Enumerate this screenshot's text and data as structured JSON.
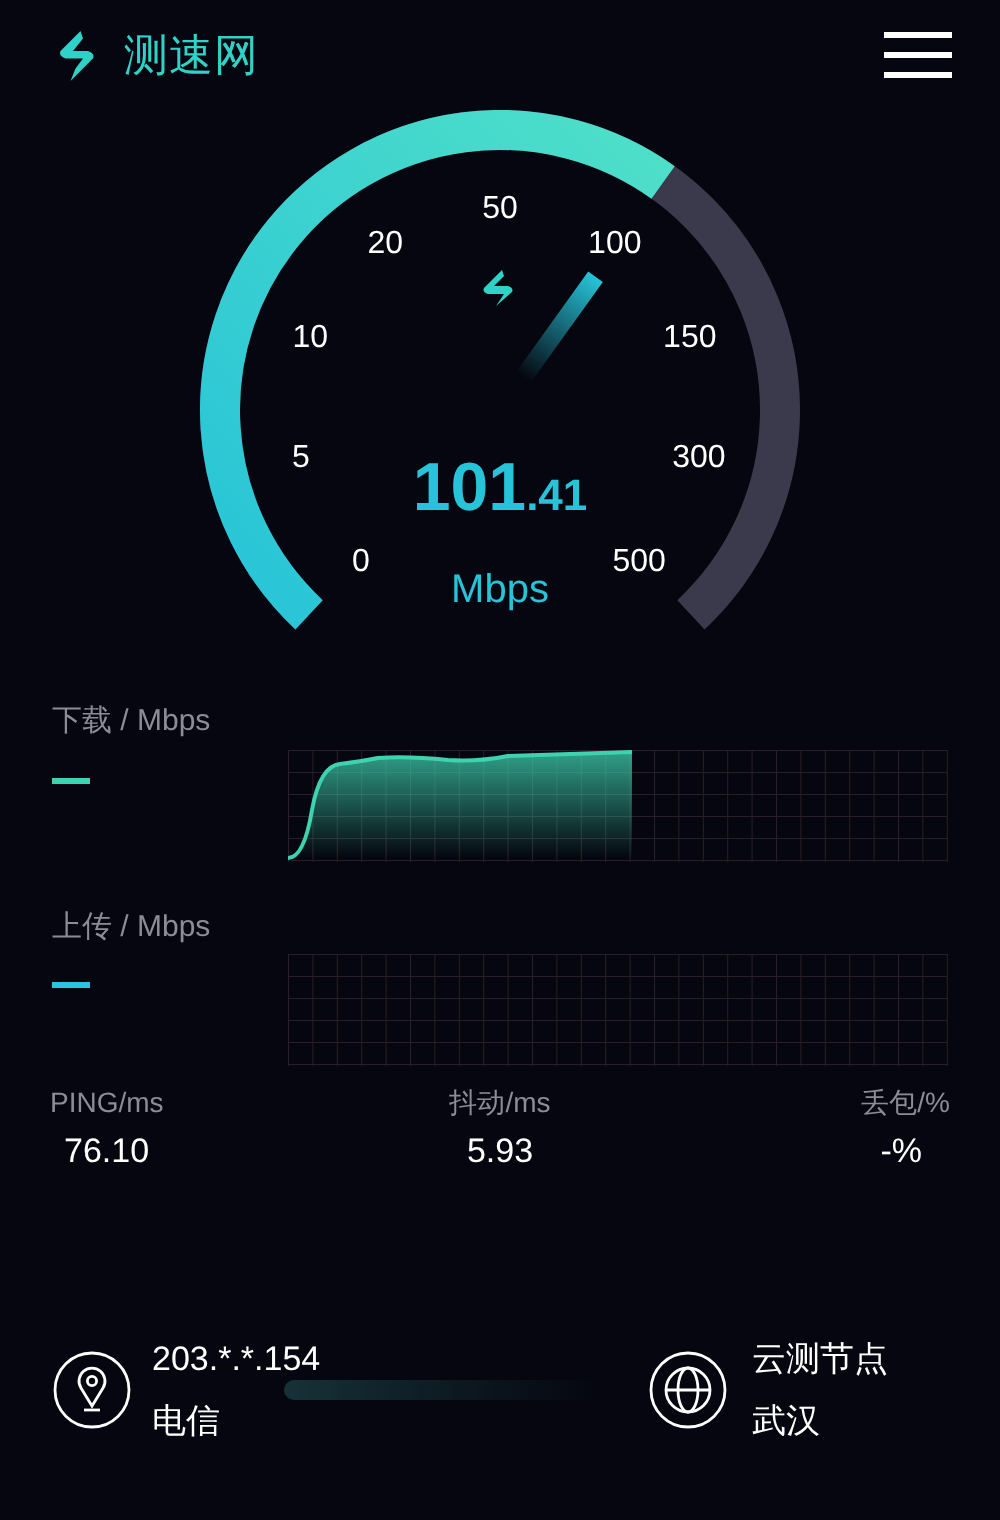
{
  "header": {
    "app_name": "测速网"
  },
  "gauge": {
    "scale": [
      "0",
      "5",
      "10",
      "20",
      "50",
      "100",
      "150",
      "300",
      "500"
    ],
    "value_whole": "101",
    "value_decimal": ".41",
    "unit": "Mbps"
  },
  "graphs": [
    {
      "label": "下载 / Mbps",
      "color": "#3ed3b0",
      "has_curve": true
    },
    {
      "label": "上传 / Mbps",
      "color": "#2bc4e0",
      "has_curve": false
    }
  ],
  "stats": [
    {
      "label": "PING/ms",
      "value": "76.10"
    },
    {
      "label": "抖动/ms",
      "value": "5.93"
    },
    {
      "label": "丢包/%",
      "value": "-%"
    }
  ],
  "client": {
    "ip": "203.*.*.154",
    "carrier": "电信"
  },
  "server": {
    "title": "云测节点",
    "city": "武汉"
  }
}
